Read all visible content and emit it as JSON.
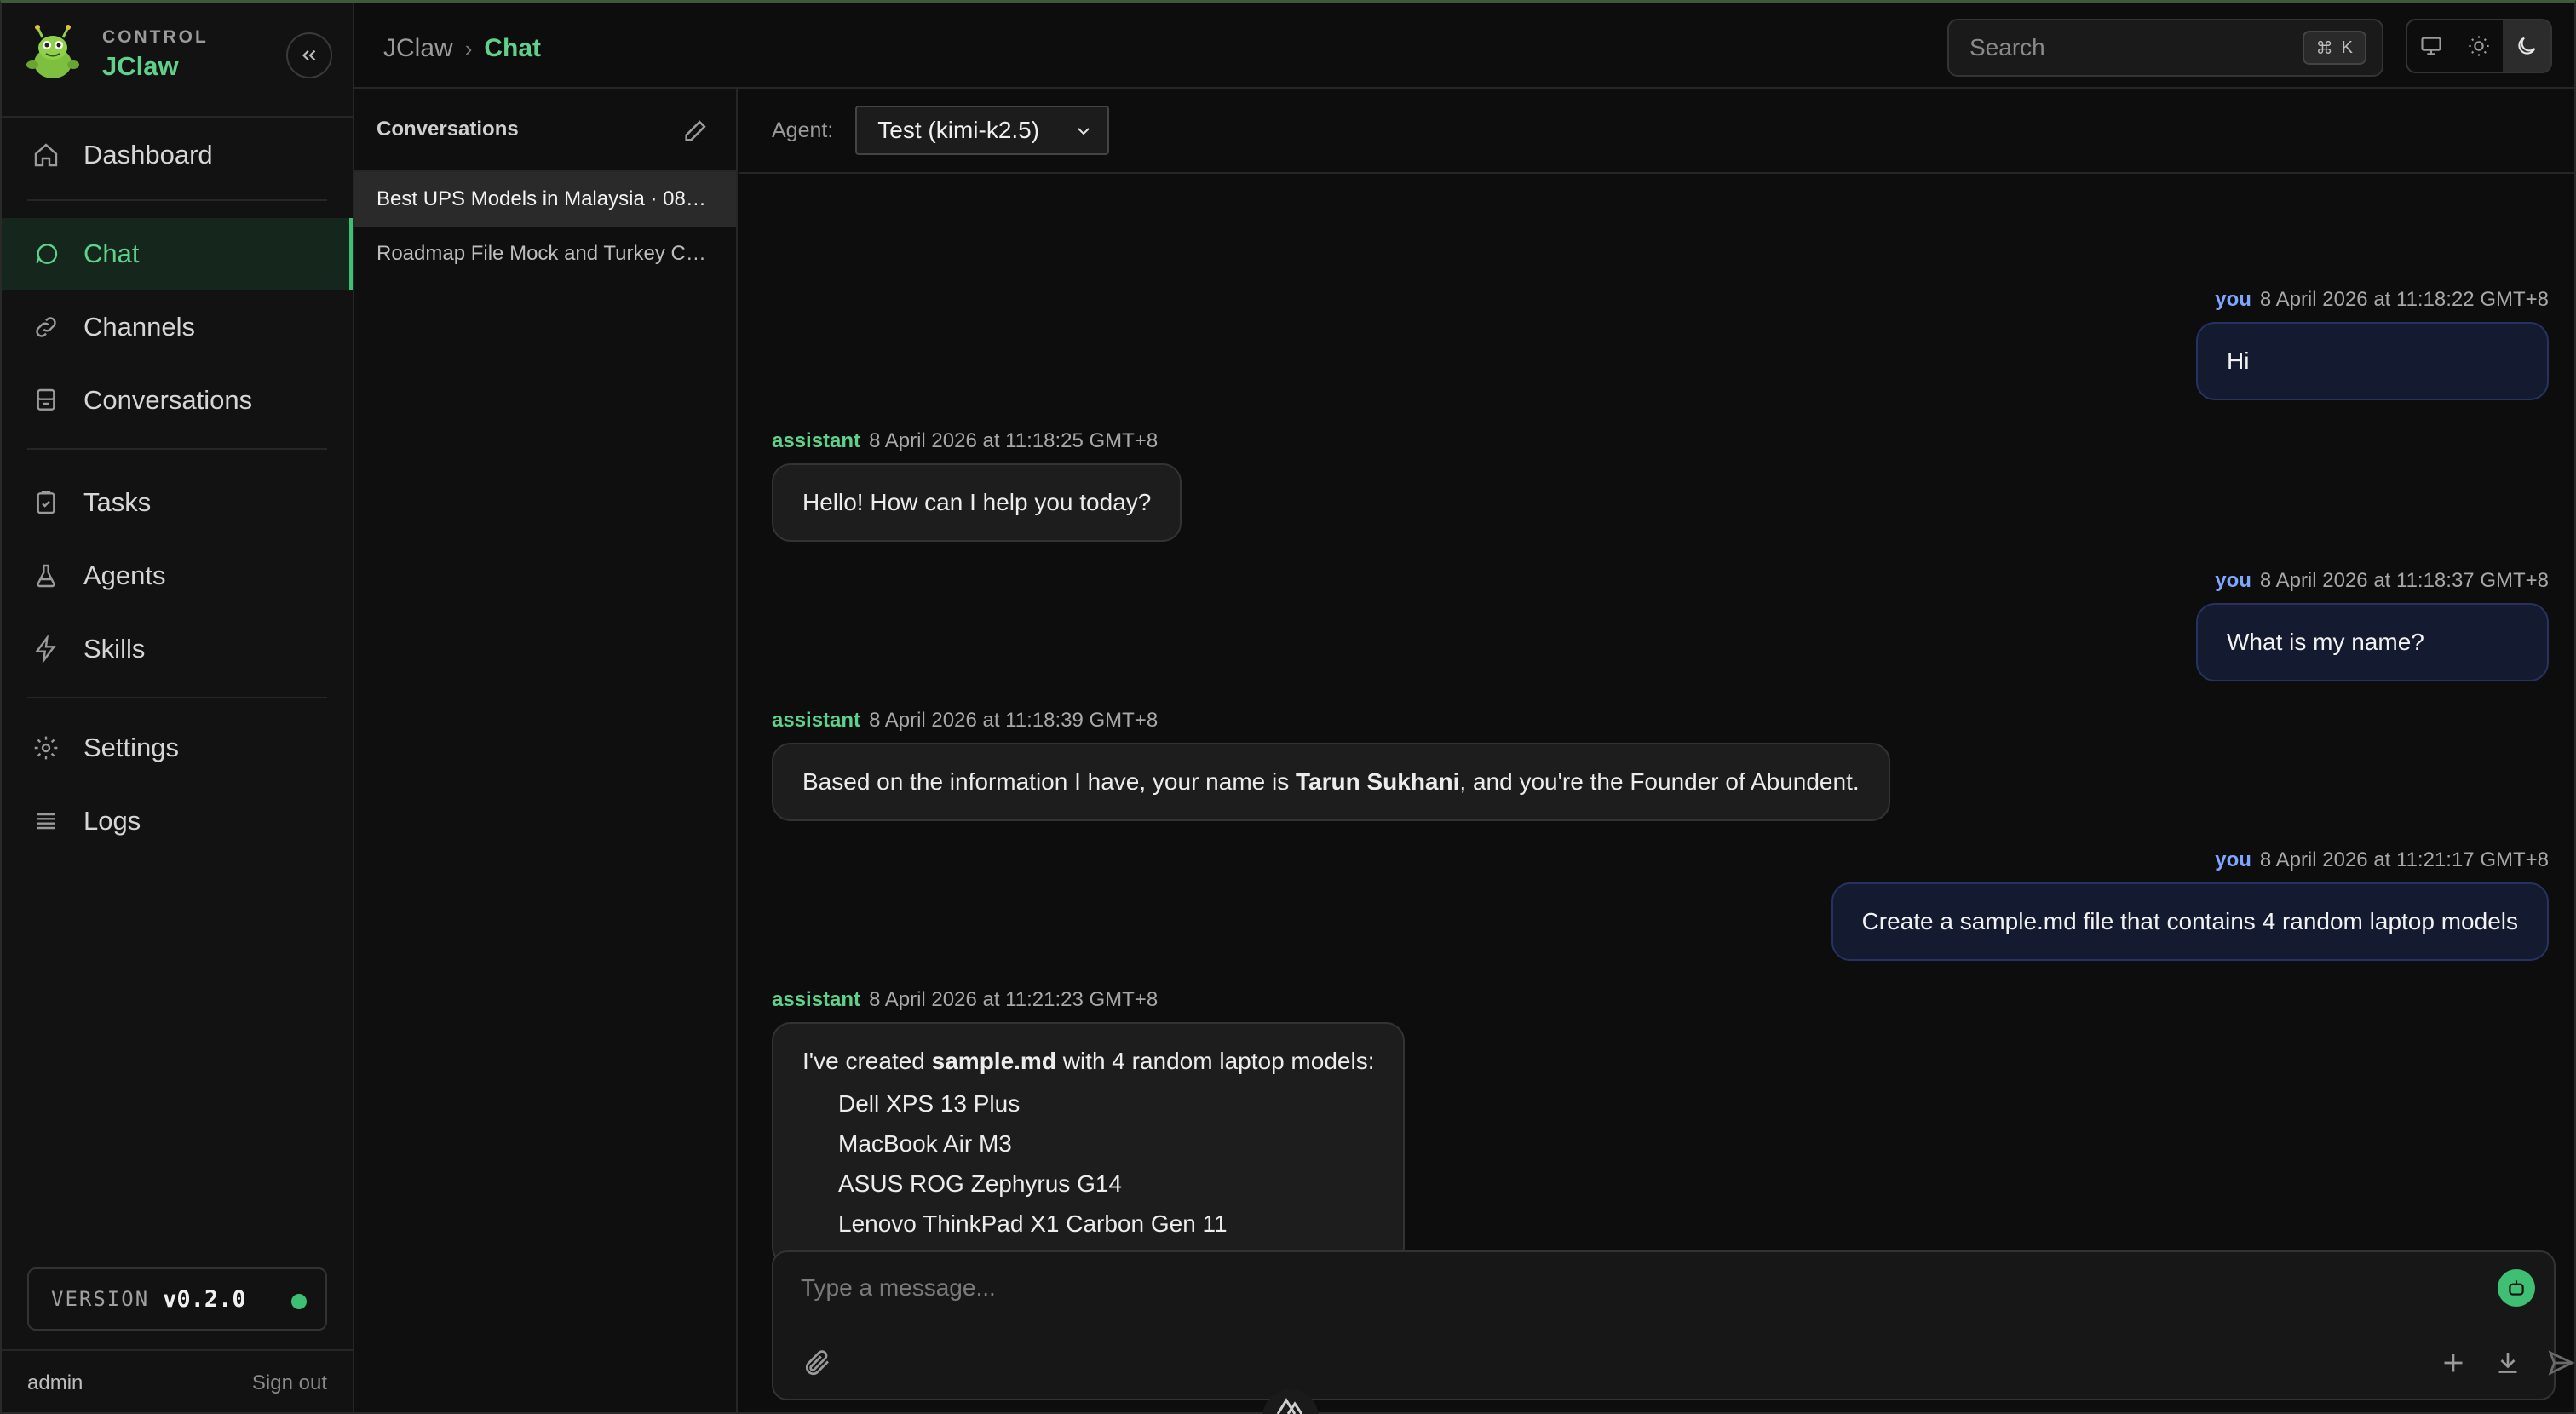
{
  "brand": {
    "sub": "CONTROL",
    "name": "JClaw"
  },
  "nav": {
    "dashboard": "Dashboard",
    "chat": "Chat",
    "channels": "Channels",
    "conversations": "Conversations",
    "tasks": "Tasks",
    "agents": "Agents",
    "skills": "Skills",
    "settings": "Settings",
    "logs": "Logs"
  },
  "version": {
    "label": "VERSION",
    "value": "v0.2.0"
  },
  "user": {
    "name": "admin",
    "sign_out": "Sign out"
  },
  "header": {
    "breadcrumb_root": "JClaw",
    "breadcrumb_sep": "›",
    "breadcrumb_current": "Chat",
    "search_placeholder": "Search",
    "search_kbd_mod": "⌘",
    "search_kbd_key": "K"
  },
  "conversations": {
    "title": "Conversations",
    "items": [
      "Best UPS Models in Malaysia · 08…",
      "Roadmap File Mock and Turkey C…"
    ]
  },
  "agent": {
    "label": "Agent:",
    "selected": "Test (kimi-k2.5)"
  },
  "messages": [
    {
      "who": "you",
      "time": "8 April 2026 at 11:18:22 GMT+8",
      "text": "Hi"
    },
    {
      "who": "assistant",
      "time": "8 April 2026 at 11:18:25 GMT+8",
      "text": "Hello! How can I help you today?"
    },
    {
      "who": "you",
      "time": "8 April 2026 at 11:18:37 GMT+8",
      "text": "What is my name?"
    },
    {
      "who": "assistant",
      "time": "8 April 2026 at 11:18:39 GMT+8",
      "text_pre": "Based on the information I have, your name is ",
      "text_bold": "Tarun Sukhani",
      "text_post": ", and you're the Founder of Abundent."
    },
    {
      "who": "you",
      "time": "8 April 2026 at 11:21:17 GMT+8",
      "text": "Create a sample.md file that contains 4 random laptop models"
    },
    {
      "who": "assistant",
      "time": "8 April 2026 at 11:21:23 GMT+8",
      "text_pre": "I've created ",
      "text_bold": "sample.md",
      "text_post": " with 4 random laptop models:",
      "list": [
        "Dell XPS 13 Plus",
        "MacBook Air M3",
        "ASUS ROG Zephyrus G14",
        "Lenovo ThinkPad X1 Carbon Gen 11"
      ]
    }
  ],
  "composer": {
    "placeholder": "Type a message..."
  },
  "colors": {
    "accent": "#5fd18a",
    "user_name": "#7ea6ff",
    "user_bubble": "#141a30",
    "assistant_bubble": "#1d1d1d",
    "active_nav": "#15261d"
  },
  "icons": {
    "collapse": "chevrons-left-icon",
    "dashboard": "home-icon",
    "chat": "message-circle-icon",
    "channels": "link-icon",
    "conversations": "archive-icon",
    "tasks": "clipboard-check-icon",
    "agents": "flask-icon",
    "skills": "lightning-icon",
    "settings": "gear-icon",
    "logs": "list-icon",
    "edit": "pencil-icon",
    "attach": "paperclip-icon",
    "add": "plus-icon",
    "download": "download-icon",
    "send": "send-icon",
    "bot": "bot-icon",
    "theme_system": "monitor-icon",
    "theme_light": "sun-icon",
    "theme_dark": "moon-icon"
  }
}
